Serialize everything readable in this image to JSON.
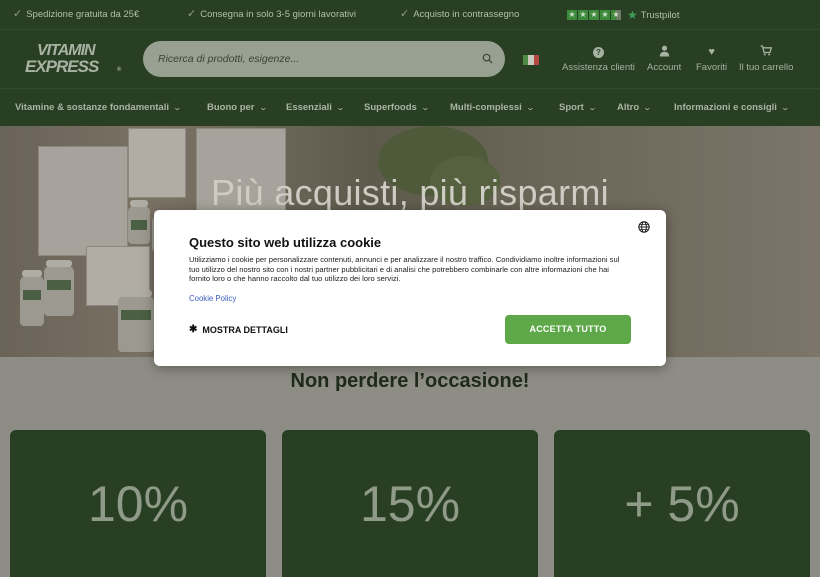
{
  "topbar": {
    "usps": [
      "Spedizione gratuita da 25€",
      "Consegna in solo 3-5 giorni lavorativi",
      "Acquisto in contrassegno"
    ],
    "trustpilot_label": "Trustpilot",
    "trustpilot_stars": 4.5
  },
  "header": {
    "logo_line1": "VITAMIN",
    "logo_line2": "EXPRESS",
    "logo_reg": "®",
    "search_placeholder": "Ricerca di prodotti, esigenze...",
    "icons": {
      "help": "Assistenza clienti",
      "account": "Account",
      "favorites": "Favoriti",
      "cart": "Il tuo carrello"
    }
  },
  "nav": {
    "items": [
      "Vitamine & sostanze fondamentali",
      "Buono per",
      "Essenziali",
      "Superfoods",
      "Multi-complessi",
      "Sport",
      "Altro",
      "Informazioni e consigli"
    ]
  },
  "hero": {
    "title": "Più acquisti, più risparmi"
  },
  "section": {
    "title": "Non perdere l’occasione!",
    "cards": [
      "10%",
      "15%",
      "+ 5%"
    ]
  },
  "cookie": {
    "title": "Questo sito web utilizza cookie",
    "body": "Utilizziamo i cookie per personalizzare contenuti, annunci e per analizzare il nostro traffico. Condividiamo inoltre informazioni sul tuo utilizzo del nostro sito con i nostri partner pubblicitari e di analisi che potrebbero combinarle con altre informazioni che hai fornito loro o che hanno raccolto dal tuo utilizzo dei loro servizi.",
    "policy_link": "Cookie Policy",
    "details_label": "MOSTRA DETTAGLI",
    "accept_label": "ACCETTA TUTTO"
  },
  "colors": {
    "brand_dark": "#283f24",
    "accept_green": "#5fa84a",
    "overlay": "#8d8d85"
  }
}
